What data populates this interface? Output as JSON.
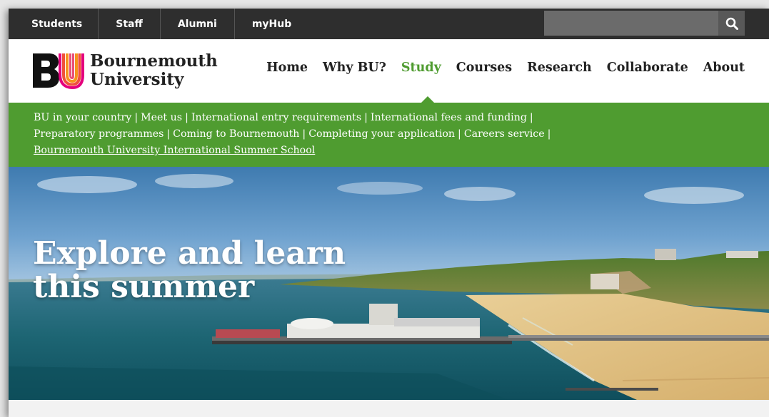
{
  "utility_nav": {
    "items": [
      {
        "label": "Students"
      },
      {
        "label": "Staff"
      },
      {
        "label": "Alumni"
      },
      {
        "label": "myHub"
      }
    ],
    "search": {
      "placeholder": "",
      "icon": "search-icon"
    }
  },
  "header": {
    "logo": {
      "mark": "BU",
      "line1": "Bournemouth",
      "line2": "University"
    },
    "nav": [
      {
        "label": "Home"
      },
      {
        "label": "Why BU?"
      },
      {
        "label": "Study",
        "active": true
      },
      {
        "label": "Courses"
      },
      {
        "label": "Research"
      },
      {
        "label": "Collaborate"
      },
      {
        "label": "About"
      }
    ]
  },
  "subnav": {
    "links": [
      "BU in your country",
      "Meet us",
      "International entry requirements",
      "International fees and funding",
      "Preparatory programmes",
      "Coming to Bournemouth",
      "Completing your application",
      "Careers service",
      "Bournemouth University International Summer School"
    ]
  },
  "hero": {
    "title_line1": "Explore and learn",
    "title_line2": "this summer"
  },
  "colors": {
    "utility_bar": "#2e2e2e",
    "accent_green": "#4f9c30",
    "text_dark": "#222222"
  }
}
